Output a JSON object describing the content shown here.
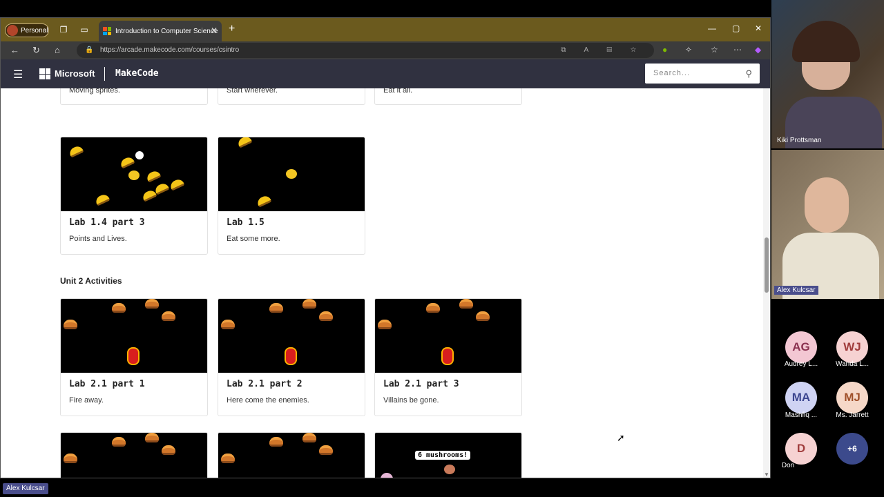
{
  "browser": {
    "profile_label": "Personal",
    "tab_title": "Introduction to Computer Science",
    "url": "https://arcade.makecode.com/courses/csintro",
    "new_tab_icon": "plus-icon",
    "window_controls": [
      "minimize-icon",
      "maximize-icon",
      "close-icon"
    ]
  },
  "header": {
    "brand": "Microsoft",
    "product": "MakeCode",
    "search_placeholder": "Search..."
  },
  "top_partial_cards": [
    {
      "desc": "Moving sprites."
    },
    {
      "desc": "Start wherever."
    },
    {
      "desc": "Eat it all."
    }
  ],
  "cards_row1": [
    {
      "title": "Lab 1.4 part 3",
      "desc": "Points and Lives."
    },
    {
      "title": "Lab 1.5",
      "desc": "Eat some more."
    }
  ],
  "section_title": "Unit 2 Activities",
  "cards_row2": [
    {
      "title": "Lab 2.1 part 1",
      "desc": "Fire away."
    },
    {
      "title": "Lab 2.1 part 2",
      "desc": "Here come the enemies."
    },
    {
      "title": "Lab 2.1 part 3",
      "desc": "Villains be gone."
    }
  ],
  "bottom_cards": [
    {
      "speech": ""
    },
    {
      "speech": ""
    },
    {
      "speech": "6 mushrooms!"
    }
  ],
  "meeting": {
    "videos": [
      {
        "name": "Kiki Prottsman"
      },
      {
        "name": "Alex Kulcsar"
      }
    ],
    "participants": [
      {
        "initials": "AG",
        "name": "Audrey L...",
        "color": "#f3c7d3"
      },
      {
        "initials": "WJ",
        "name": "Wanda L...",
        "color": "#f6d2d2"
      },
      {
        "initials": "MA",
        "name": "Mashfiq ...",
        "color": "#cfd3f3"
      },
      {
        "initials": "MJ",
        "name": "Ms. Jarrett",
        "color": "#f6d8c8"
      },
      {
        "initials": "D",
        "name": "Don",
        "color": "#f6d2d2"
      },
      {
        "initials": "+6",
        "name": "",
        "color": "#3c4a8c"
      }
    ],
    "presenter_label": "Alex Kulcsar"
  }
}
